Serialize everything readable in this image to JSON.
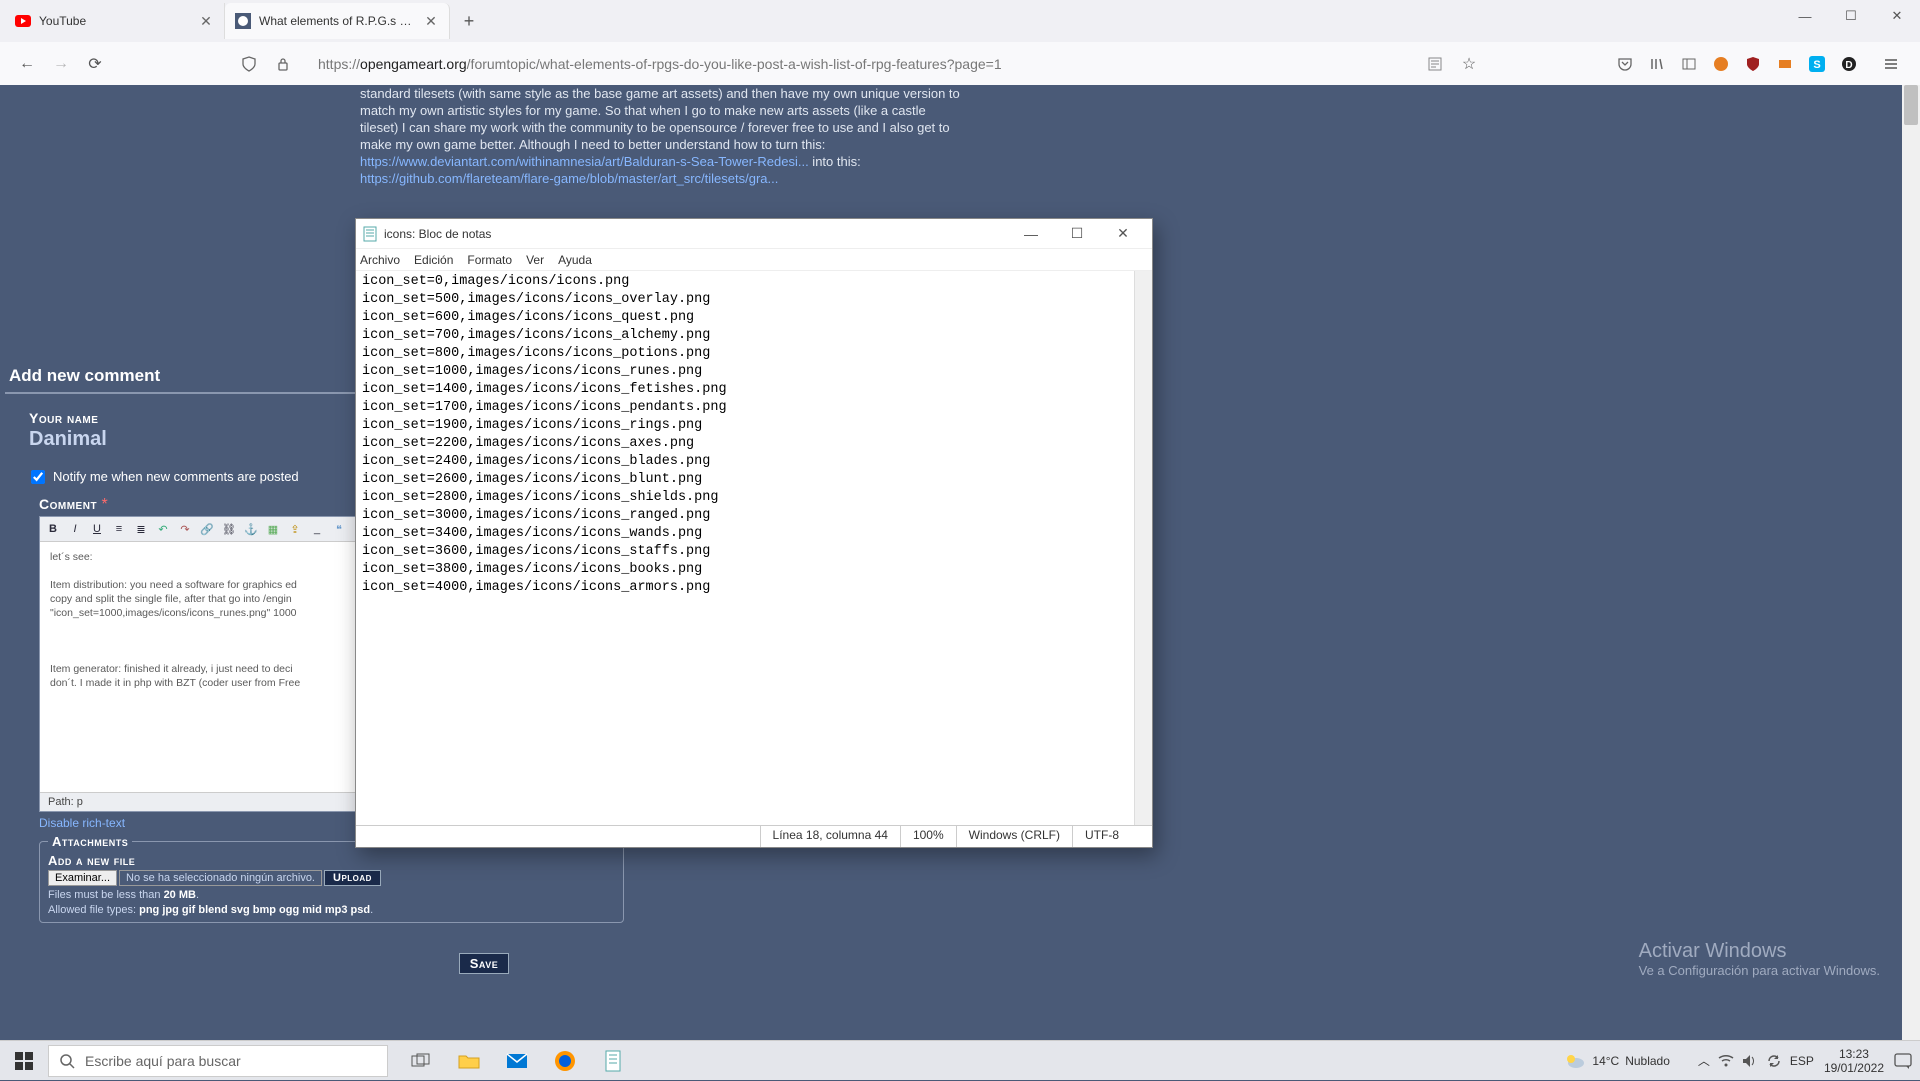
{
  "browser": {
    "tabs": [
      {
        "title": "YouTube",
        "favicon": "youtube"
      },
      {
        "title": "What elements of R.P.G.s do yo",
        "favicon": "oga"
      }
    ],
    "window_controls": {
      "min": "—",
      "max": "☐",
      "close": "✕"
    },
    "url_prefix": "https://",
    "url_host": "opengameart.org",
    "url_path": "/forumtopic/what-elements-of-rpgs-do-you-like-post-a-wish-list-of-rpg-features?page=1"
  },
  "post": {
    "text_a": "standard tilesets (with same style as the base game art assets) and then have my own unique version to match my own artistic styles for my game. So that when I go to make new arts assets (like a castle tileset) I can share my work with the community to be opensource / forever free to use and I also get to make my own game better. Although I need to better understand how to turn this: ",
    "link1": "https://www.deviantart.com/withinamnesia/art/Balduran-s-Sea-Tower-Redesi...",
    "mid1": " into this: ",
    "link2": "https://github.com/flareteam/flare-game/blob/master/art_src/tilesets/gra...",
    "add_comment_header": "Add new comment",
    "your_name_label": "Your name",
    "username": "Danimal",
    "notify_label": "Notify me when new comments are posted",
    "comment_label": "Comment",
    "editor_text": "let´s see:\n\nItem distribution: you need a software for graphics ed\ncopy and split the single file, after that go into /engin\n\"icon_set=1000,images/icons/icons_runes.png\" 1000 \n\n\n\nItem generator: finished it already, i just need to deci\ndon´t. I made it in php with BZT (coder user from Free",
    "editor_path": "Path: p",
    "disable_rich": "Disable rich-text",
    "attachments_legend": "Attachments",
    "add_file_label": "Add a new file",
    "browse_btn": "Examinar...",
    "no_file": "No se ha seleccionado ningún archivo.",
    "upload_btn": "Upload",
    "file_hint1a": "Files must be less than ",
    "file_hint1b": "20 MB",
    "file_hint2a": "Allowed file types: ",
    "file_hint2b": "png jpg gif blend svg bmp ogg mid mp3 psd",
    "save_btn": "Save"
  },
  "notepad": {
    "title": "icons: Bloc de notas",
    "menu": [
      "Archivo",
      "Edición",
      "Formato",
      "Ver",
      "Ayuda"
    ],
    "content": "icon_set=0,images/icons/icons.png\nicon_set=500,images/icons/icons_overlay.png\nicon_set=600,images/icons/icons_quest.png\nicon_set=700,images/icons/icons_alchemy.png\nicon_set=800,images/icons/icons_potions.png\nicon_set=1000,images/icons/icons_runes.png\nicon_set=1400,images/icons/icons_fetishes.png\nicon_set=1700,images/icons/icons_pendants.png\nicon_set=1900,images/icons/icons_rings.png\nicon_set=2200,images/icons/icons_axes.png\nicon_set=2400,images/icons/icons_blades.png\nicon_set=2600,images/icons/icons_blunt.png\nicon_set=2800,images/icons/icons_shields.png\nicon_set=3000,images/icons/icons_ranged.png\nicon_set=3400,images/icons/icons_wands.png\nicon_set=3600,images/icons/icons_staffs.png\nicon_set=3800,images/icons/icons_books.png\nicon_set=4000,images/icons/icons_armors.png",
    "status": {
      "pos": "Línea 18, columna 44",
      "zoom": "100%",
      "eol": "Windows (CRLF)",
      "enc": "UTF-8"
    }
  },
  "watermark": {
    "line1": "Activar Windows",
    "line2": "Ve a Configuración para activar Windows."
  },
  "taskbar": {
    "search_placeholder": "Escribe aquí para buscar",
    "weather_temp": "14°C",
    "weather_cond": "Nublado",
    "lang": "ESP",
    "time": "13:23",
    "date": "19/01/2022"
  }
}
